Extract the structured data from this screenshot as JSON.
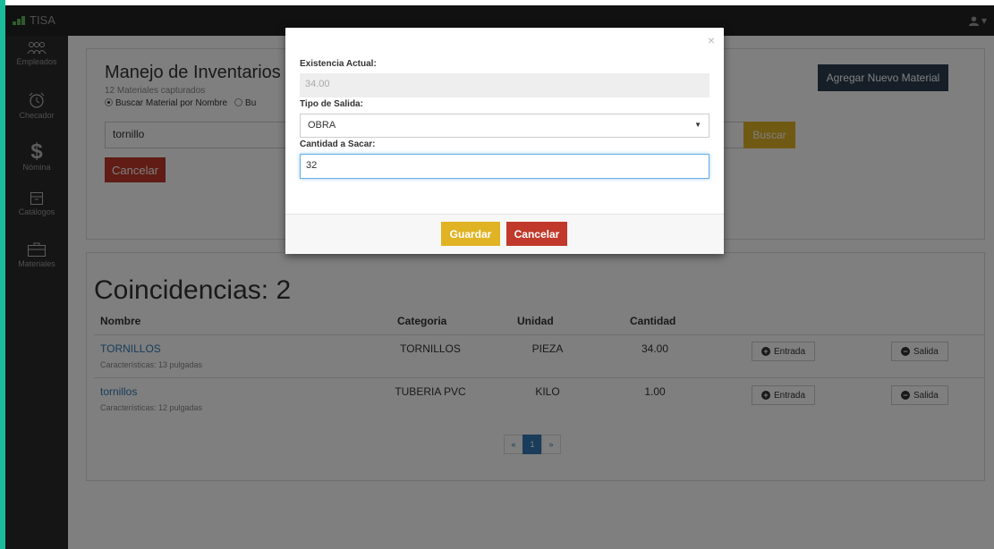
{
  "navbar": {
    "brand": "TISA",
    "user_icon": "user-icon"
  },
  "sidebar": {
    "items": [
      {
        "label": "Empleados",
        "icon": "people-icon"
      },
      {
        "label": "Checador",
        "icon": "alarm-clock-icon"
      },
      {
        "label": "Nómina",
        "icon": "dollar-icon",
        "glyph": "$"
      },
      {
        "label": "Catálogos",
        "icon": "archive-icon"
      },
      {
        "label": "Materiales",
        "icon": "briefcase-icon"
      }
    ]
  },
  "inventory": {
    "title": "Manejo de Inventarios",
    "subtitle": "12 Materiales capturados",
    "radio_nombre": "Buscar Material por Nombre",
    "radio_other": "Bu",
    "search_value": "tornillo",
    "buscar_label": "Buscar",
    "cancel_label": "Cancelar",
    "add_label": "Agregar Nuevo Material"
  },
  "results": {
    "title": "Coincidencias: 2",
    "headers": {
      "nombre": "Nombre",
      "categoria": "Categoria",
      "unidad": "Unidad",
      "cantidad": "Cantidad"
    },
    "rows": [
      {
        "nombre": "TORNILLOS",
        "caracteristicas": "Características: 13 pulgadas",
        "categoria": "TORNILLOS",
        "unidad": "PIEZA",
        "cantidad": "34.00",
        "entrada": "Entrada",
        "salida": "Salida"
      },
      {
        "nombre": "tornillos",
        "caracteristicas": "Características: 12 pulgadas",
        "categoria": "TUBERIA PVC",
        "unidad": "KILO",
        "cantidad": "1.00",
        "entrada": "Entrada",
        "salida": "Salida"
      }
    ],
    "pager": {
      "prev": "«",
      "page": "1",
      "next": "»"
    }
  },
  "modal": {
    "close": "×",
    "existencia_label": "Existencia Actual:",
    "existencia_value": "34.00",
    "tipo_label": "Tipo de Salida:",
    "tipo_value": "OBRA",
    "cantidad_label": "Cantidad a Sacar:",
    "cantidad_value": "32",
    "guardar_label": "Guardar",
    "cancelar_label": "Cancelar"
  }
}
